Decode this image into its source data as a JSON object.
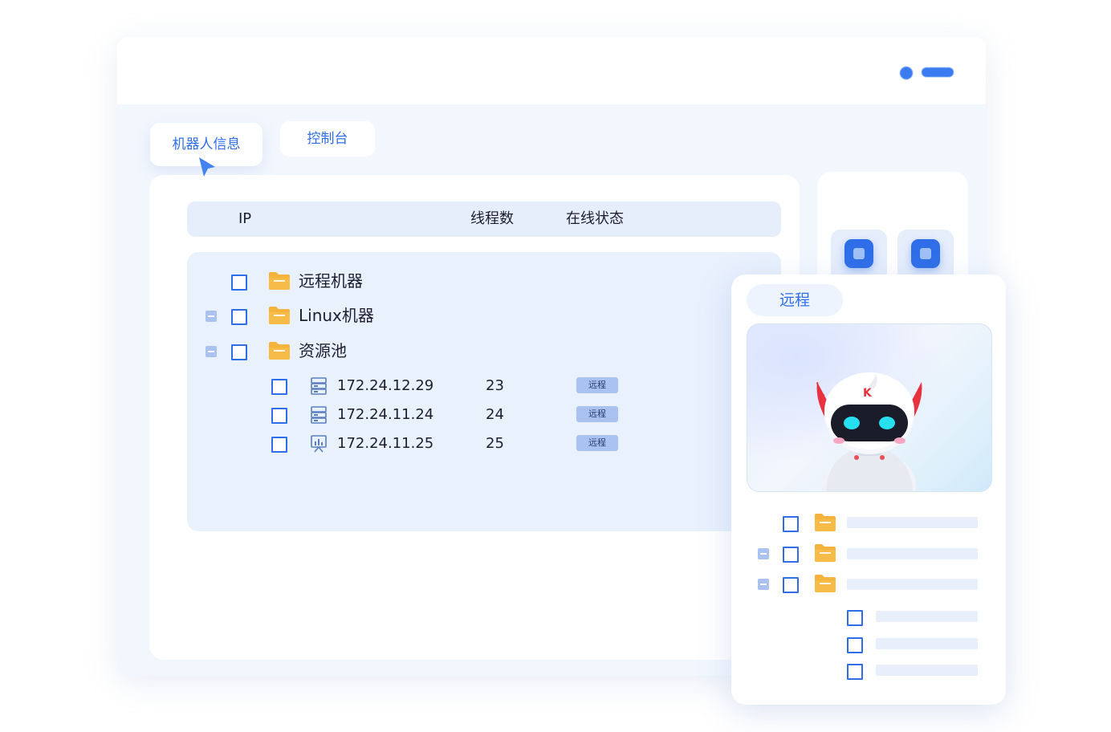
{
  "tabs": {
    "robot_info": "机器人信息",
    "console": "控制台"
  },
  "table": {
    "headers": {
      "ip": "IP",
      "threads": "线程数",
      "status": "在线状态"
    }
  },
  "tree": {
    "groups": [
      {
        "label": "远程机器",
        "expandable": false
      },
      {
        "label": "Linux机器",
        "expandable": true
      },
      {
        "label": "资源池",
        "expandable": true
      }
    ],
    "machines": [
      {
        "ip": "172.24.12.29",
        "threads": "23",
        "status": "远程",
        "icon": "server-icon"
      },
      {
        "ip": "172.24.11.24",
        "threads": "24",
        "status": "远程",
        "icon": "server-icon"
      },
      {
        "ip": "172.24.11.25",
        "threads": "25",
        "status": "远程",
        "icon": "presentation-chart-icon"
      }
    ]
  },
  "card": {
    "tab_label": "远程",
    "image_alt": "robot-mascot-image"
  },
  "colors": {
    "accent": "#2f6ee8",
    "folder": "#f4b33d",
    "badge": "#a9c2ef",
    "panel_bg": "#e9f1fd"
  }
}
